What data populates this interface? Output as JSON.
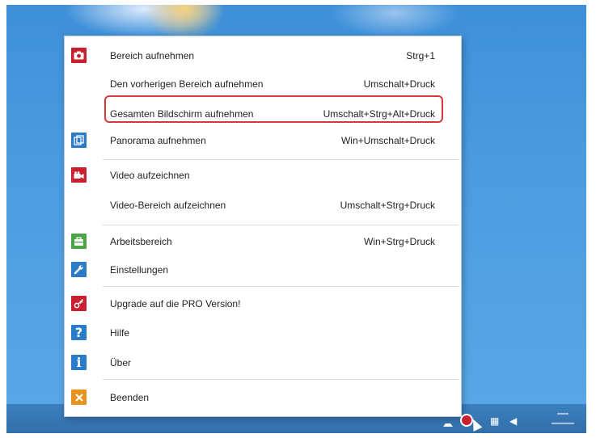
{
  "menu": {
    "items": [
      {
        "label": "Bereich aufnehmen",
        "shortcut": "Strg+1",
        "icon": "camera-icon",
        "icon_color": "#c8202e",
        "glyph": "◙"
      },
      {
        "label": "Den vorherigen Bereich aufnehmen",
        "shortcut": "Umschalt+Druck"
      },
      {
        "label": "Gesamten Bildschirm aufnehmen",
        "shortcut": "Umschalt+Strg+Alt+Druck"
      },
      {
        "label": "Panorama aufnehmen",
        "shortcut": "Win+Umschalt+Druck",
        "icon": "panorama-icon",
        "icon_color": "#2a7bc8",
        "glyph": "⧉"
      },
      {
        "label": "Video aufzeichnen",
        "shortcut": "",
        "icon": "video-camera-icon",
        "icon_color": "#c8202e",
        "glyph": "■"
      },
      {
        "label": "Video-Bereich aufzeichnen",
        "shortcut": "Umschalt+Strg+Druck"
      },
      {
        "label": "Arbeitsbereich",
        "shortcut": "Win+Strg+Druck",
        "icon": "workspace-icon",
        "icon_color": "#4aa546",
        "glyph": "▭"
      },
      {
        "label": "Einstellungen",
        "shortcut": "",
        "icon": "wrench-icon",
        "icon_color": "#2a7bc8",
        "glyph": "✎"
      },
      {
        "label": "Upgrade auf die PRO Version!",
        "shortcut": "",
        "icon": "key-icon",
        "icon_color": "#c8202e",
        "glyph": "⚷"
      },
      {
        "label": "Hilfe",
        "shortcut": "",
        "icon": "help-icon",
        "icon_color": "#2a7bc8",
        "glyph": "?"
      },
      {
        "label": "Über",
        "shortcut": "",
        "icon": "info-icon",
        "icon_color": "#2a7bc8",
        "glyph": "i"
      },
      {
        "label": "Beenden",
        "shortcut": "",
        "icon": "close-icon",
        "icon_color": "#e69320",
        "glyph": "✕"
      }
    ],
    "highlighted_item": "Gesamten Bildschirm aufnehmen",
    "highlight_color": "#d9383a"
  },
  "taskbar": {
    "tray_icons": [
      "tray-arrow-icon",
      "screenshot-app-icon",
      "network-icon",
      "volume-icon"
    ]
  }
}
